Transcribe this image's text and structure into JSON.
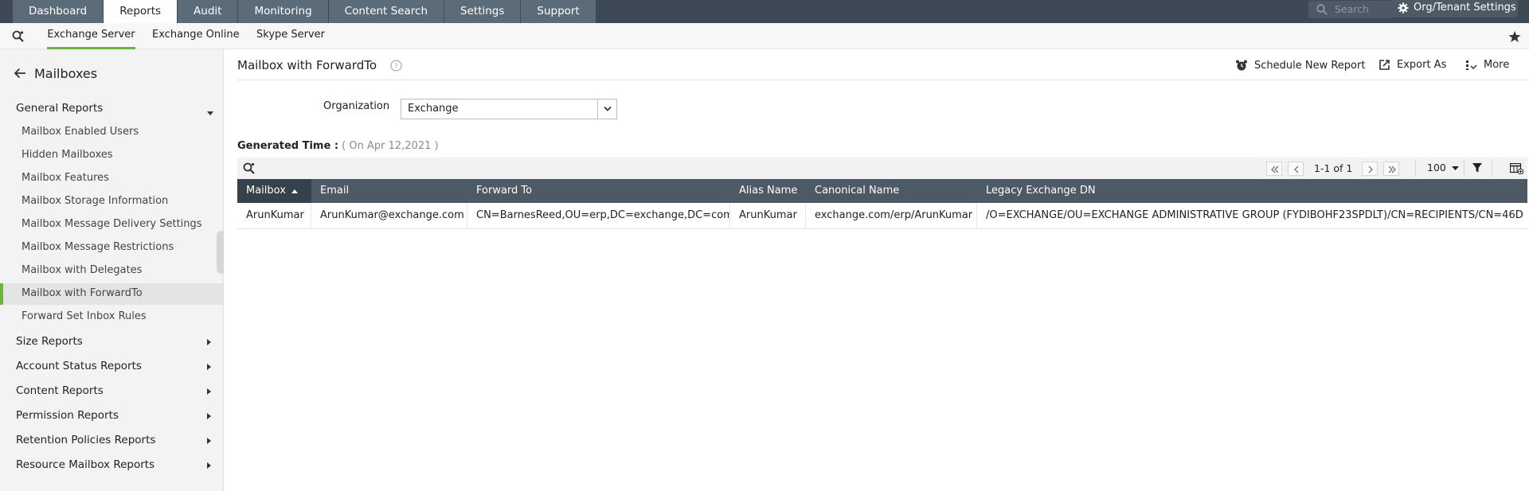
{
  "topnav": {
    "tabs": [
      {
        "label": "Dashboard",
        "active": false
      },
      {
        "label": "Reports",
        "active": true
      },
      {
        "label": "Audit",
        "active": false
      },
      {
        "label": "Monitoring",
        "active": false
      },
      {
        "label": "Content Search",
        "active": false
      },
      {
        "label": "Settings",
        "active": false
      },
      {
        "label": "Support",
        "active": false
      }
    ],
    "search_placeholder": "Search",
    "org_settings": "Org/Tenant Settings"
  },
  "subnav": {
    "tabs": [
      {
        "label": "Exchange Server",
        "active": true
      },
      {
        "label": "Exchange Online",
        "active": false
      },
      {
        "label": "Skype Server",
        "active": false
      }
    ]
  },
  "sidebar": {
    "back_label": "Mailboxes",
    "sections": [
      {
        "label": "General Reports",
        "expanded": true
      },
      {
        "label": "Size Reports"
      },
      {
        "label": "Account Status Reports"
      },
      {
        "label": "Content Reports"
      },
      {
        "label": "Permission Reports"
      },
      {
        "label": "Retention Policies Reports"
      },
      {
        "label": "Resource Mailbox Reports"
      }
    ],
    "general_items": [
      "Mailbox Enabled Users",
      "Hidden Mailboxes",
      "Mailbox Features",
      "Mailbox Storage Information",
      "Mailbox Message Delivery Settings",
      "Mailbox Message Restrictions",
      "Mailbox with Delegates",
      "Mailbox with ForwardTo",
      "Forward Set Inbox Rules"
    ],
    "selected_item": "Mailbox with ForwardTo"
  },
  "page": {
    "title": "Mailbox with ForwardTo",
    "actions": {
      "schedule": "Schedule New Report",
      "export": "Export As",
      "more": "More"
    },
    "organization_label": "Organization",
    "organization_value": "Exchange",
    "generated_label": "Generated Time :",
    "generated_value": "( On Apr 12,2021 )"
  },
  "pager": {
    "info": "1-1 of 1",
    "page_size": "100"
  },
  "table": {
    "columns": [
      "Mailbox",
      "Email",
      "Forward To",
      "Alias Name",
      "Canonical Name",
      "Legacy Exchange DN"
    ],
    "sorted_column": "Mailbox",
    "rows": [
      [
        "ArunKumar",
        "ArunKumar@exchange.com",
        "CN=BarnesReed,OU=erp,DC=exchange,DC=com",
        "ArunKumar",
        "exchange.com/erp/ArunKumar",
        "/O=EXCHANGE/OU=EXCHANGE ADMINISTRATIVE GROUP (FYDIBOHF23SPDLT)/CN=RECIPIENTS/CN=46D"
      ]
    ]
  },
  "colors": {
    "accent_green": "#6cb33f",
    "nav_dark": "#3d4a55",
    "grid_header": "#4d5a65"
  }
}
